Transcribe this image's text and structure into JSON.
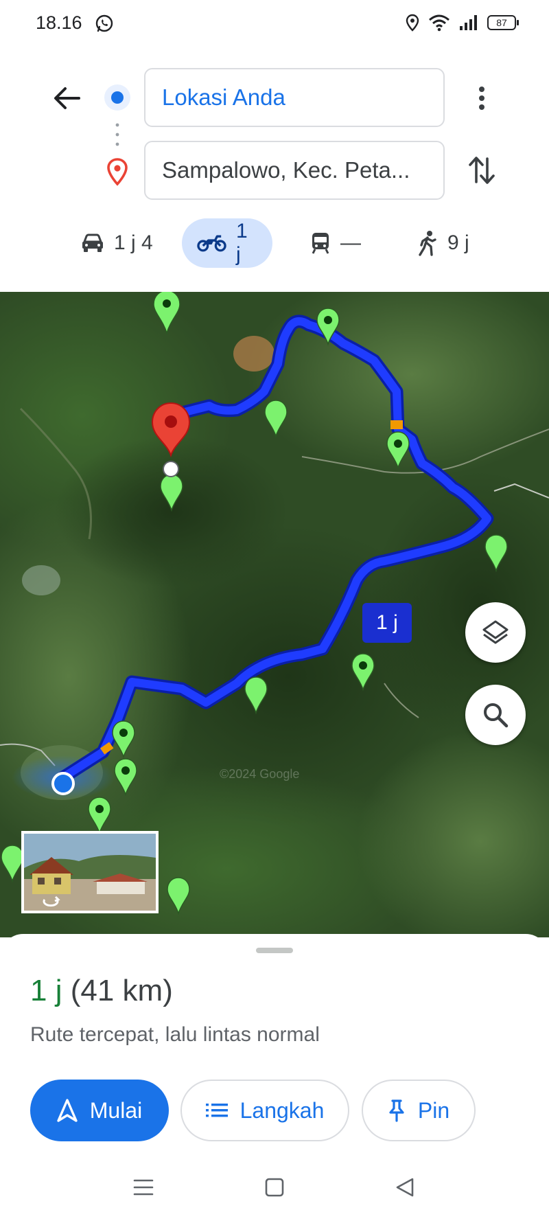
{
  "status_bar": {
    "time": "18.16",
    "battery": "87"
  },
  "directions": {
    "origin": "Lokasi Anda",
    "destination": "Sampalowo, Kec. Peta..."
  },
  "modes": [
    {
      "name": "car",
      "label": "1 j 4",
      "active": false
    },
    {
      "name": "motorcycle",
      "label": "1 j",
      "active": true
    },
    {
      "name": "transit",
      "label": "—",
      "active": false
    },
    {
      "name": "walk",
      "label": "9 j",
      "active": false
    }
  ],
  "map": {
    "route_label": "1 j",
    "watermark": "©2024 Google"
  },
  "route_summary": {
    "duration": "1 j",
    "distance": "(41 km)",
    "description": "Rute tercepat, lalu lintas normal"
  },
  "actions": {
    "start": "Mulai",
    "steps": "Langkah",
    "pin": "Pin"
  },
  "colors": {
    "accent": "#1a73e8",
    "route": "#1f3cff",
    "duration": "#188038",
    "active_mode_bg": "#d3e3fd",
    "pin_red": "#ea4335",
    "marker_green": "#7cf26e"
  }
}
